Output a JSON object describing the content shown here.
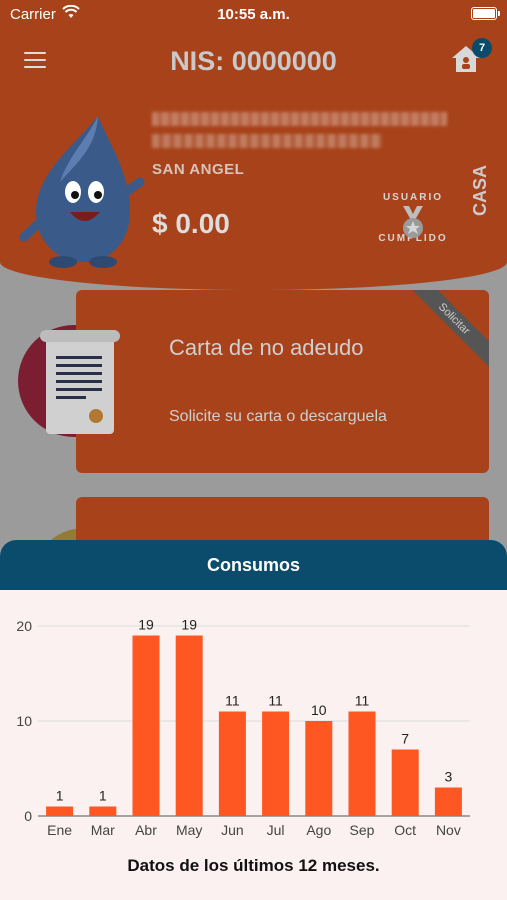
{
  "status_bar": {
    "carrier": "Carrier",
    "time": "10:55 a.m."
  },
  "header": {
    "title": "NIS: 0000000",
    "notification_count": "7",
    "location": "SAN ANGEL",
    "balance": "$ 0.00",
    "user_status_line1": "USUARIO",
    "user_status_line2": "CUMPLIDO",
    "account_type": "CASA"
  },
  "cards": [
    {
      "title": "Carta de no adeudo",
      "description": "Solicite su carta o descarguela",
      "ribbon": "Solicitar"
    }
  ],
  "sheet": {
    "title": "Consumos",
    "caption": "Datos de los últimos 12 meses."
  },
  "colors": {
    "header_bg": "#a8421a",
    "sheet_header_bg": "#0b4c6d",
    "bar_color": "#fe5722"
  },
  "chart_data": {
    "type": "bar",
    "categories": [
      "Ene",
      "Mar",
      "Abr",
      "May",
      "Jun",
      "Jul",
      "Ago",
      "Sep",
      "Oct",
      "Nov"
    ],
    "values": [
      1,
      1,
      19,
      19,
      11,
      11,
      10,
      11,
      7,
      3
    ],
    "yticks": [
      0,
      10,
      20
    ],
    "ylim": [
      0,
      20
    ],
    "grid": true,
    "data_labels": true
  }
}
